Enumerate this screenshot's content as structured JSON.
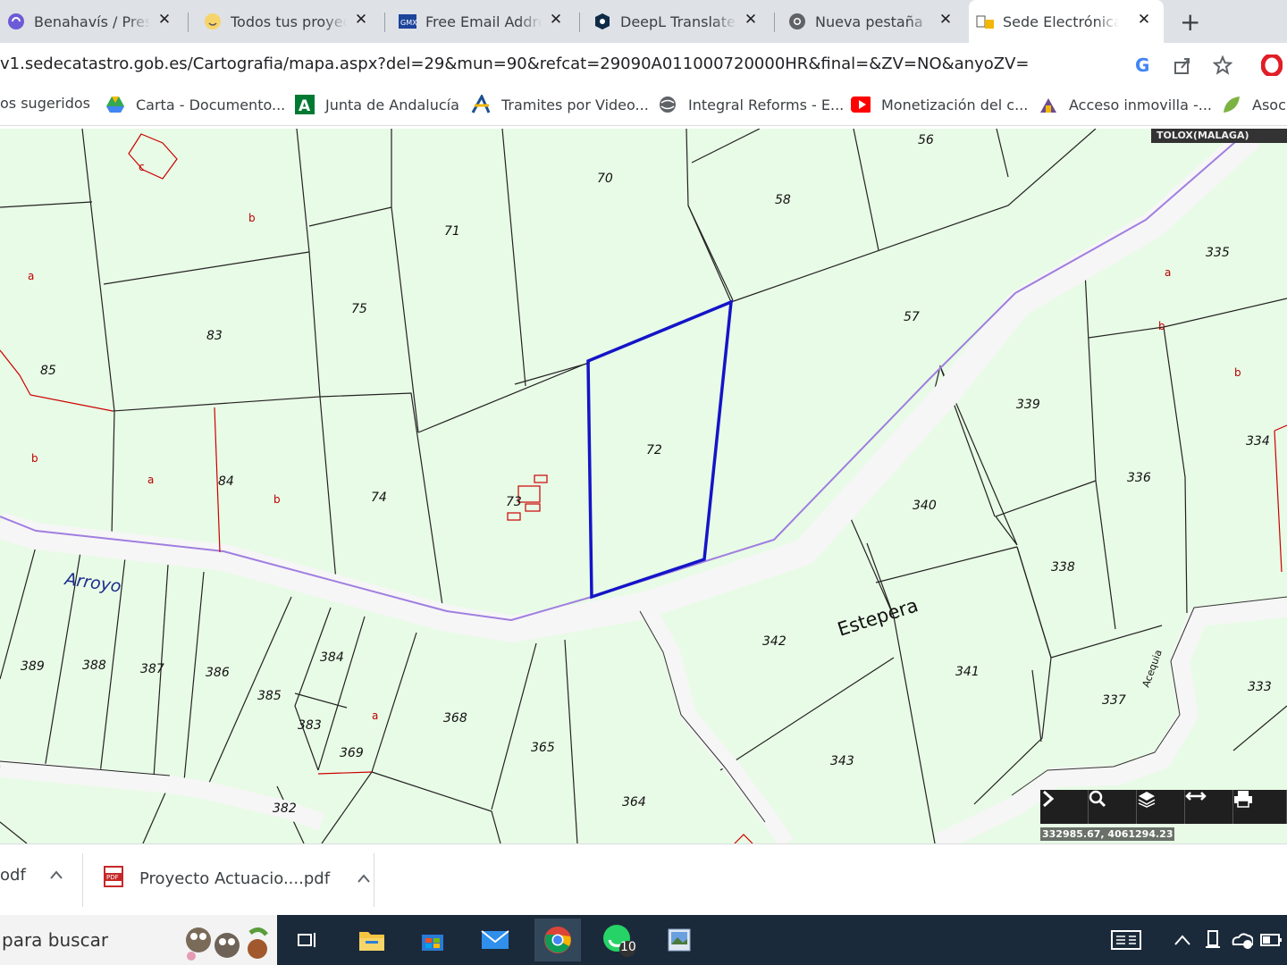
{
  "tabs": [
    {
      "label": "Benahavís / Presu",
      "icon": "loop-icon",
      "active": false
    },
    {
      "label": "Todos tus proyec",
      "icon": "smiley-icon",
      "active": false
    },
    {
      "label": "Free Email Addre",
      "icon": "gmx-icon",
      "active": false
    },
    {
      "label": "DeepL Translate",
      "icon": "deepl-icon",
      "active": false
    },
    {
      "label": "Nueva pestaña",
      "icon": "chrome-icon",
      "active": false
    },
    {
      "label": "Sede Electrónica",
      "icon": "catastro-icon",
      "active": true
    }
  ],
  "address_bar": {
    "url": "v1.sedecatastro.gob.es/Cartografia/mapa.aspx?del=29&mun=90&refcat=29090A011000720000HR&final=&ZV=NO&anyoZV="
  },
  "bookmarks": [
    {
      "label": "os sugeridos",
      "icon": ""
    },
    {
      "label": "Carta - Documento...",
      "icon": "drive-icon"
    },
    {
      "label": "Junta de Andalucía",
      "icon": "junta-andalucia-icon"
    },
    {
      "label": "Tramites por Video...",
      "icon": "agencia-tributaria-icon"
    },
    {
      "label": "Integral Reforms - E...",
      "icon": "globe-icon"
    },
    {
      "label": "Monetización del c...",
      "icon": "youtube-icon"
    },
    {
      "label": "Acceso inmovilla -...",
      "icon": "inmovilla-icon"
    },
    {
      "label": "Asoci",
      "icon": "leaf-icon"
    }
  ],
  "map": {
    "municipality": "TOLOX(MALAGA)",
    "coordinates": "332985.67, 4061294.23",
    "street_labels": [
      "Arroyo",
      "Estepera",
      "Acequia"
    ],
    "parcels": [
      "56",
      "70",
      "58",
      "71",
      "75",
      "83",
      "85",
      "335",
      "57",
      "339",
      "334",
      "72",
      "73",
      "74",
      "84",
      "336",
      "340",
      "338",
      "389",
      "388",
      "387",
      "386",
      "385",
      "384",
      "383",
      "369",
      "368",
      "382",
      "365",
      "364",
      "342",
      "341",
      "343",
      "337",
      "333"
    ],
    "subparcels": [
      "c",
      "b",
      "a",
      "a",
      "b",
      "a",
      "b",
      "a",
      "a",
      "a"
    ],
    "tools": [
      "next-icon",
      "zoom-icon",
      "layers-icon",
      "measure-icon",
      "print-icon"
    ]
  },
  "downloads": [
    {
      "label": "odf"
    },
    {
      "label": "Proyecto Actuacio....pdf"
    }
  ],
  "taskbar": {
    "search_placeholder": "para buscar",
    "apps": [
      "task-view-icon",
      "file-explorer-icon",
      "store-icon",
      "mail-icon",
      "chrome-icon",
      "whatsapp-icon",
      "image-viewer-icon"
    ],
    "whatsapp_badge": "10"
  }
}
